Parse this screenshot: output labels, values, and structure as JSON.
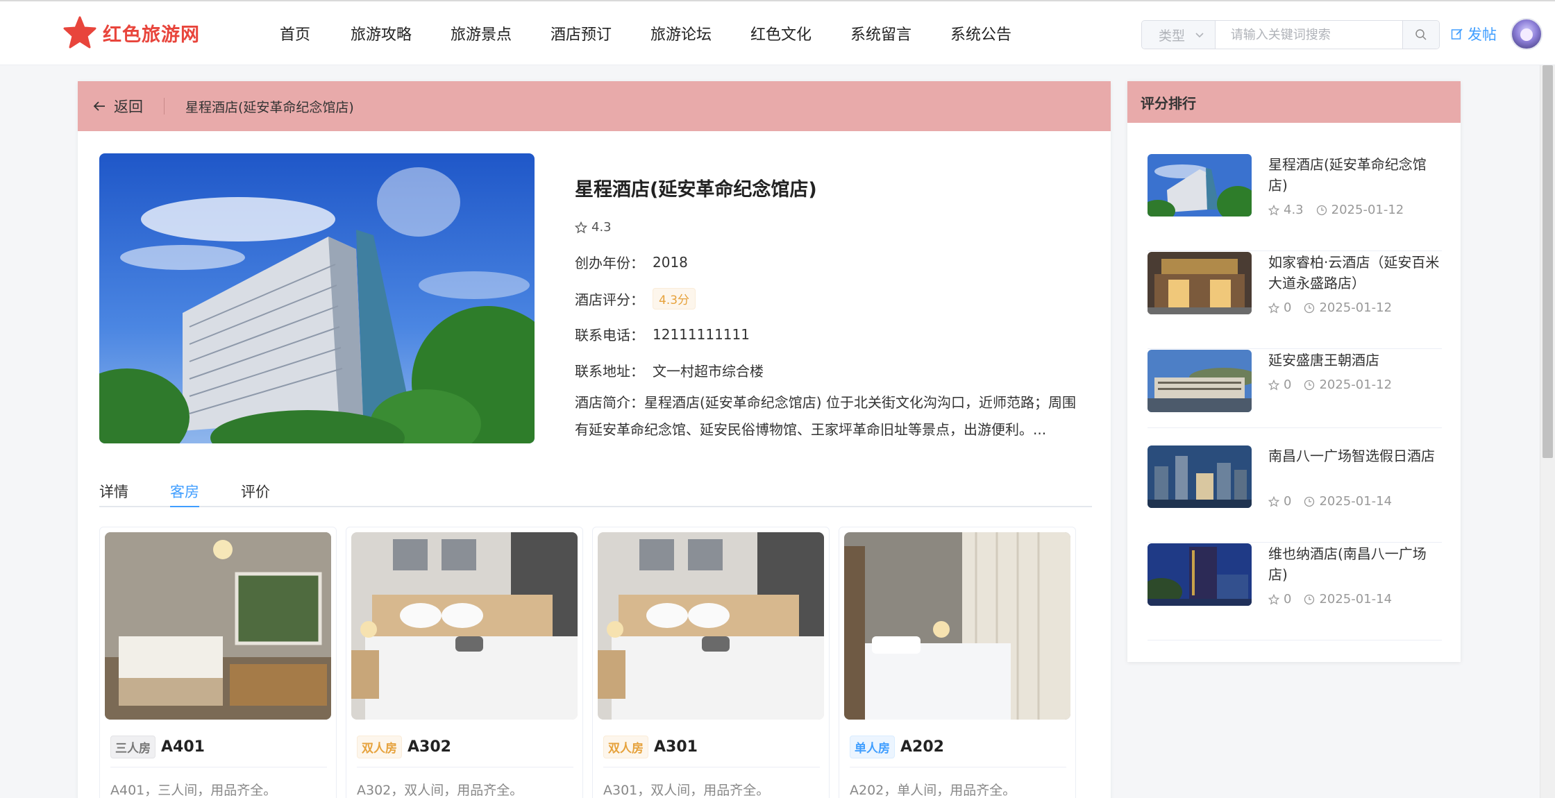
{
  "app": {
    "name": "红色旅游网",
    "colors": {
      "brand": "#e8453c",
      "accent": "#409eff",
      "header_band": "#e8aaaa"
    }
  },
  "nav": {
    "items": [
      {
        "label": "首页"
      },
      {
        "label": "旅游攻略"
      },
      {
        "label": "旅游景点"
      },
      {
        "label": "酒店预订"
      },
      {
        "label": "旅游论坛"
      },
      {
        "label": "红色文化"
      },
      {
        "label": "系统留言"
      },
      {
        "label": "系统公告"
      }
    ]
  },
  "search": {
    "type_placeholder": "类型",
    "placeholder": "请输入关键词搜索",
    "value": ""
  },
  "post_label": "发帖",
  "breadcrumb": {
    "back_label": "返回",
    "current": "星程酒店(延安革命纪念馆店)"
  },
  "hotel": {
    "name": "星程酒店(延安革命纪念馆店)",
    "rating": "4.3",
    "fields": [
      {
        "label": "创办年份：",
        "value": "2018"
      },
      {
        "label": "酒店评分：",
        "value": "4.3分"
      },
      {
        "label": "联系电话：",
        "value": "12111111111"
      },
      {
        "label": "联系地址：",
        "value": "文一村超市综合楼"
      }
    ],
    "intro_label": "酒店简介：",
    "intro_text": "星程酒店(延安革命纪念馆店) 位于北关街文化沟沟口，近师范路；周围有延安革命纪念馆、延安民俗博物馆、王家坪革命旧址等景点，出游便利。..."
  },
  "tabs": [
    {
      "label": "详情"
    },
    {
      "label": "客房"
    },
    {
      "label": "评价"
    }
  ],
  "rooms": [
    {
      "tag": "三人房",
      "name": "A401",
      "desc": "A401，三人间，用品齐全。"
    },
    {
      "tag": "双人房",
      "name": "A302",
      "desc": "A302，双人间，用品齐全。"
    },
    {
      "tag": "双人房",
      "name": "A301",
      "desc": "A301，双人间，用品齐全。"
    },
    {
      "tag": "单人房",
      "name": "A202",
      "desc": "A202，单人间，用品齐全。"
    }
  ],
  "ranking": {
    "title": "评分排行",
    "items": [
      {
        "title": "星程酒店(延安革命纪念馆店)",
        "score": "4.3",
        "date": "2025-01-12"
      },
      {
        "title": "如家睿柏·云酒店（延安百米大道永盛路店）",
        "score": "0",
        "date": "2025-01-12"
      },
      {
        "title": "延安盛唐王朝酒店",
        "score": "0",
        "date": "2025-01-12"
      },
      {
        "title": "南昌八一广场智选假日酒店",
        "score": "0",
        "date": "2025-01-14"
      },
      {
        "title": "维也纳酒店(南昌八一广场店)",
        "score": "0",
        "date": "2025-01-14"
      }
    ]
  }
}
